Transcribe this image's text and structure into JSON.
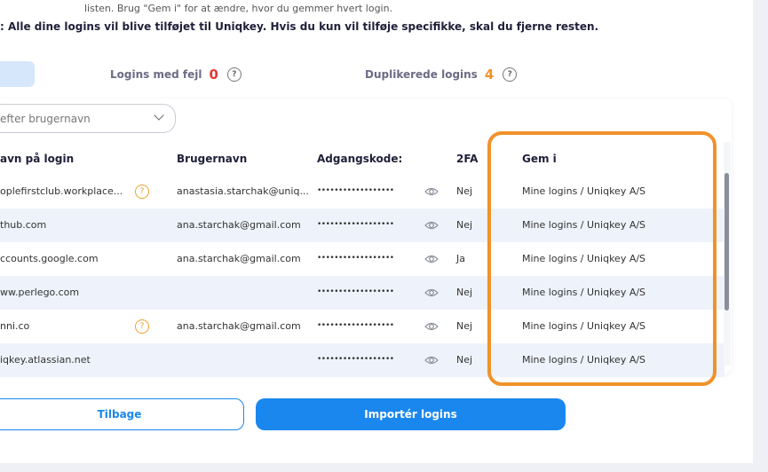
{
  "header": {
    "top_note": "listen. Brug \"Gem i\" for at ændre, hvor du gemmer hvert login.",
    "warning": ": Alle dine logins vil blive tilføjet til Uniqkey. Hvis du kun vil tilføje specifikke, skal du fjerne resten."
  },
  "stats": {
    "errors_label": "Logins med fejl",
    "errors_count": "0",
    "duplicates_label": "Duplikerede logins",
    "duplicates_count": "4",
    "help_glyph": "?"
  },
  "search": {
    "placeholder": "efter brugernavn"
  },
  "table": {
    "headers": {
      "name": "avn på login",
      "username": "Brugernavn",
      "password": "Adgangskode:",
      "twofa": "2FA",
      "save": "Gem i"
    },
    "rows": [
      {
        "name": "oplefirstclub.workplace...",
        "warning": true,
        "username": "anastasia.starchak@uniq...",
        "password": "••••••••••••••••••",
        "twofa": "Nej",
        "save": "Mine logins / Uniqkey A/S"
      },
      {
        "name": "thub.com",
        "warning": false,
        "username": "ana.starchak@gmail.com",
        "password": "••••••••••••••••••",
        "twofa": "Nej",
        "save": "Mine logins / Uniqkey A/S"
      },
      {
        "name": "ccounts.google.com",
        "warning": false,
        "username": "ana.starchak@gmail.com",
        "password": "••••••••••••••••••",
        "twofa": "Ja",
        "save": "Mine logins / Uniqkey A/S"
      },
      {
        "name": "ww.perlego.com",
        "warning": false,
        "username": "",
        "password": "••••••••••••••••••",
        "twofa": "Nej",
        "save": "Mine logins / Uniqkey A/S"
      },
      {
        "name": "nni.co",
        "warning": true,
        "username": "ana.starchak@gmail.com",
        "password": "••••••••••••••••••",
        "twofa": "Nej",
        "save": "Mine logins / Uniqkey A/S"
      },
      {
        "name": "iqkey.atlassian.net",
        "warning": false,
        "username": "",
        "password": "••••••••••••••••••",
        "twofa": "Nej",
        "save": "Mine logins / Uniqkey A/S"
      }
    ]
  },
  "buttons": {
    "back": "Tilbage",
    "import": "Importér logins"
  },
  "colors": {
    "accent": "#1a87ee",
    "error": "#e53935",
    "warning": "#f0922a",
    "row_alt": "#eef3fb"
  },
  "icons": {
    "help": "help-circle-icon",
    "warning": "question-circle-icon",
    "eye": "eye-icon",
    "dropdown": "chevron-down-icon"
  }
}
